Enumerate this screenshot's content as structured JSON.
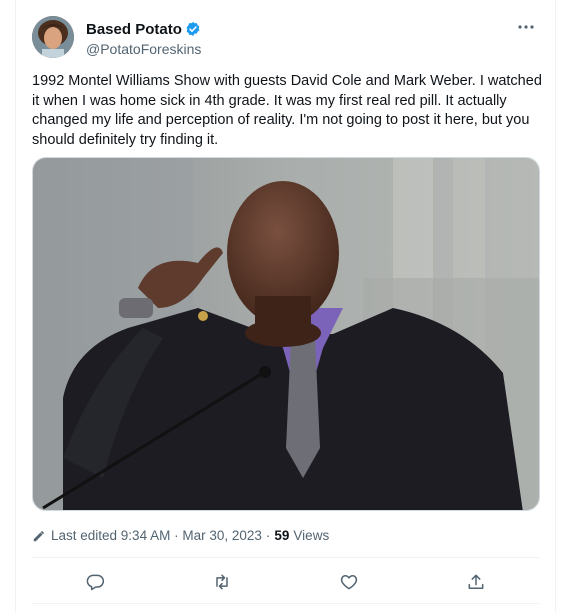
{
  "author": {
    "display_name": "Based Potato",
    "handle": "@PotatoForeskins",
    "verified": true,
    "verified_color": "#1d9bf0"
  },
  "tweet": {
    "text": "1992 Montel Williams Show with guests David Cole and Mark Weber.  I watched it when I was home sick in 4th grade.  It was my first real red pill.  It actually changed my life and perception of reality.  I'm not going to post it here, but you should definitely try finding it."
  },
  "meta": {
    "edited_label": "Last edited 9:34 AM · Mar 30, 2023",
    "separator": "·",
    "views_count": "59",
    "views_label": "Views"
  },
  "icons": {
    "more": "more-icon",
    "verified": "verified-badge-icon",
    "edit": "edit-pencil-icon",
    "reply": "reply-icon",
    "retweet": "retweet-icon",
    "like": "like-icon",
    "share": "share-icon"
  },
  "colors": {
    "text_primary": "#0f1419",
    "text_secondary": "#536471",
    "border": "#eff3f4"
  }
}
